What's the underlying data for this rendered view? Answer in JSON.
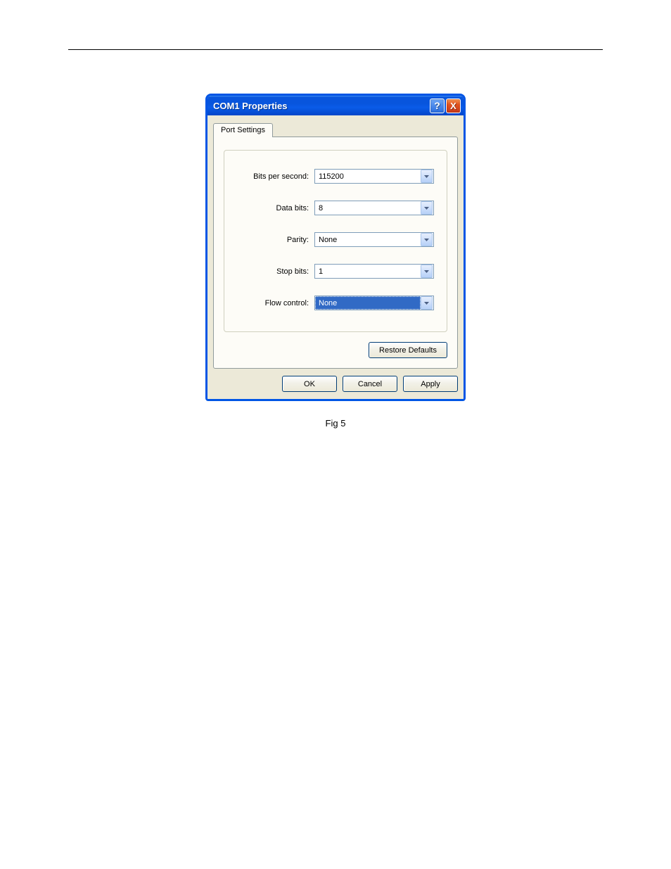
{
  "window": {
    "title": "COM1 Properties",
    "help_symbol": "?",
    "close_symbol": "X"
  },
  "tab": {
    "label": "Port Settings"
  },
  "fields": {
    "bits_per_second": {
      "label": "Bits per second:",
      "value": "115200"
    },
    "data_bits": {
      "label": "Data bits:",
      "value": "8"
    },
    "parity": {
      "label": "Parity:",
      "value": "None"
    },
    "stop_bits": {
      "label": "Stop bits:",
      "value": "1"
    },
    "flow_control": {
      "label": "Flow control:",
      "value": "None",
      "selected": true
    }
  },
  "buttons": {
    "restore": "Restore Defaults",
    "ok": "OK",
    "cancel": "Cancel",
    "apply": "Apply"
  },
  "caption": "Fig 5"
}
